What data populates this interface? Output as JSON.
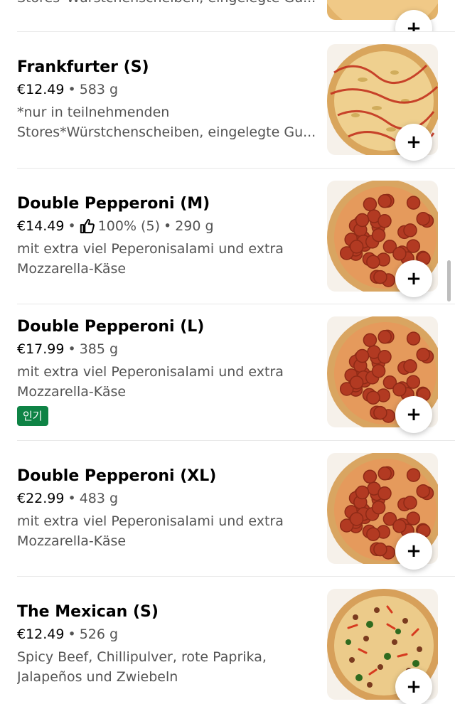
{
  "partial_item": {
    "desc": "Stores*Würstchenscheiben, eingelegte Gu...",
    "add_label": "+"
  },
  "items": [
    {
      "name": "Frankfurter (S)",
      "price": "€12.49",
      "weight": "583 g",
      "desc_lines": [
        "*nur in teilnehmenden",
        "Stores*Würstchenscheiben, eingelegte Gu..."
      ],
      "add_label": "+",
      "pizza": "frankfurter"
    },
    {
      "name": "Double Pepperoni (M)",
      "price": "€14.49",
      "rating": "100% (5)",
      "weight": "290 g",
      "desc_lines": [
        "mit extra viel Peperonisalami und extra",
        "Mozzarella-Käse"
      ],
      "add_label": "+",
      "pizza": "pepperoni"
    },
    {
      "name": "Double Pepperoni (L)",
      "price": "€17.99",
      "weight": "385 g",
      "desc_lines": [
        "mit extra viel Peperonisalami und extra",
        "Mozzarella-Käse"
      ],
      "badge": "인기",
      "add_label": "+",
      "pizza": "pepperoni"
    },
    {
      "name": "Double Pepperoni (XL)",
      "price": "€22.99",
      "weight": "483 g",
      "desc_lines": [
        "mit extra viel Peperonisalami und extra",
        "Mozzarella-Käse"
      ],
      "add_label": "+",
      "pizza": "pepperoni"
    },
    {
      "name": "The Mexican (S)",
      "price": "€12.49",
      "weight": "526 g",
      "desc_lines": [
        "Spicy Beef, Chillipulver, rote Paprika,",
        "Jalapeños und Zwiebeln"
      ],
      "add_label": "+",
      "pizza": "mexican"
    }
  ],
  "meta_separator": "•",
  "colors": {
    "badge_bg": "#0e8345",
    "text_primary": "#000000",
    "text_secondary": "#545454"
  }
}
